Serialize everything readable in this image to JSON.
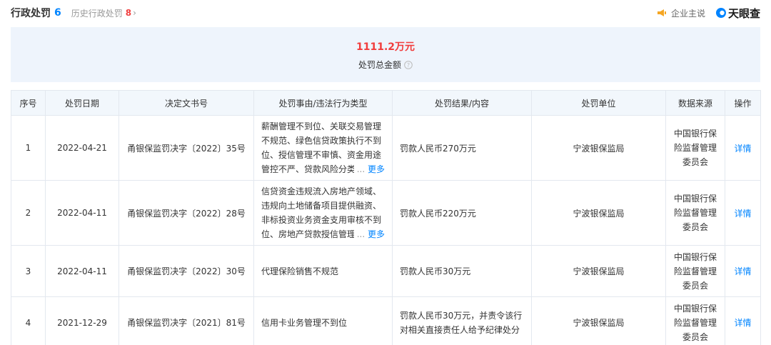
{
  "header": {
    "title": "行政处罚",
    "count": "6",
    "history_label": "历史行政处罚",
    "history_count": "8",
    "history_chevron": "›",
    "claim_label": "企业主说",
    "claim_icon": "megaphone-icon",
    "brand_label": "天眼查",
    "brand_icon": "tianyancha-logo-icon"
  },
  "summary": {
    "amount": "1111.2万元",
    "label": "处罚总金额",
    "help_icon": "question-circle-icon"
  },
  "table": {
    "columns": [
      "序号",
      "处罚日期",
      "决定文书号",
      "处罚事由/违法行为类型",
      "处罚结果/内容",
      "处罚单位",
      "数据来源",
      "操作"
    ],
    "rows": [
      {
        "index": "1",
        "date": "2022-04-21",
        "doc": "甬银保监罚决字〔2022〕35号",
        "reason": "薪酬管理不到位、关联交易管理不规范、绿色信贷政策执行不到位、授信管理不审慎、资金用途管控不严、贷款风险分类",
        "reason_ellipsis": "...",
        "reason_more": "更多",
        "result": "罚款人民币270万元",
        "unit": "宁波银保监局",
        "source": "中国银行保险监督管理委员会",
        "action": "详情"
      },
      {
        "index": "2",
        "date": "2022-04-11",
        "doc": "甬银保监罚决字〔2022〕28号",
        "reason": "信贷资金违规流入房地产领域、违规向土地储备项目提供融资、非标投资业务资金支用审核不到位、房地产贷款授信管理",
        "reason_ellipsis": "...",
        "reason_more": "更多",
        "result": "罚款人民币220万元",
        "unit": "宁波银保监局",
        "source": "中国银行保险监督管理委员会",
        "action": "详情"
      },
      {
        "index": "3",
        "date": "2022-04-11",
        "doc": "甬银保监罚决字〔2022〕30号",
        "reason": "代理保险销售不规范",
        "result": "罚款人民币30万元",
        "unit": "宁波银保监局",
        "source": "中国银行保险监督管理委员会",
        "action": "详情"
      },
      {
        "index": "4",
        "date": "2021-12-29",
        "doc": "甬银保监罚决字〔2021〕81号",
        "reason": "信用卡业务管理不到位",
        "result": "罚款人民币30万元，并责令该行对相关直接责任人给予纪律处分",
        "unit": "宁波银保监局",
        "source": "中国银行保险监督管理委员会",
        "action": "详情"
      }
    ]
  }
}
